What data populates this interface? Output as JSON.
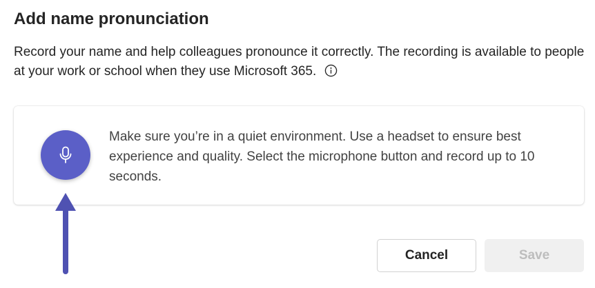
{
  "dialog": {
    "title": "Add name pronunciation",
    "description": "Record your name and help colleagues pronounce it correctly. The recording is available to people at your work or school when they use Microsoft 365.",
    "info_icon": "info-icon"
  },
  "card": {
    "mic_icon": "microphone-icon",
    "instructions": "Make sure you’re in a quiet environment. Use a headset to ensure best experience and quality. Select the microphone button and record up to 10 seconds."
  },
  "actions": {
    "cancel_label": "Cancel",
    "save_label": "Save",
    "save_enabled": false
  },
  "colors": {
    "accent": "#5b5fc7",
    "arrow": "#4f52b2",
    "text": "#242424",
    "disabled_bg": "#f0f0f0",
    "disabled_text": "#bdbdbd"
  }
}
